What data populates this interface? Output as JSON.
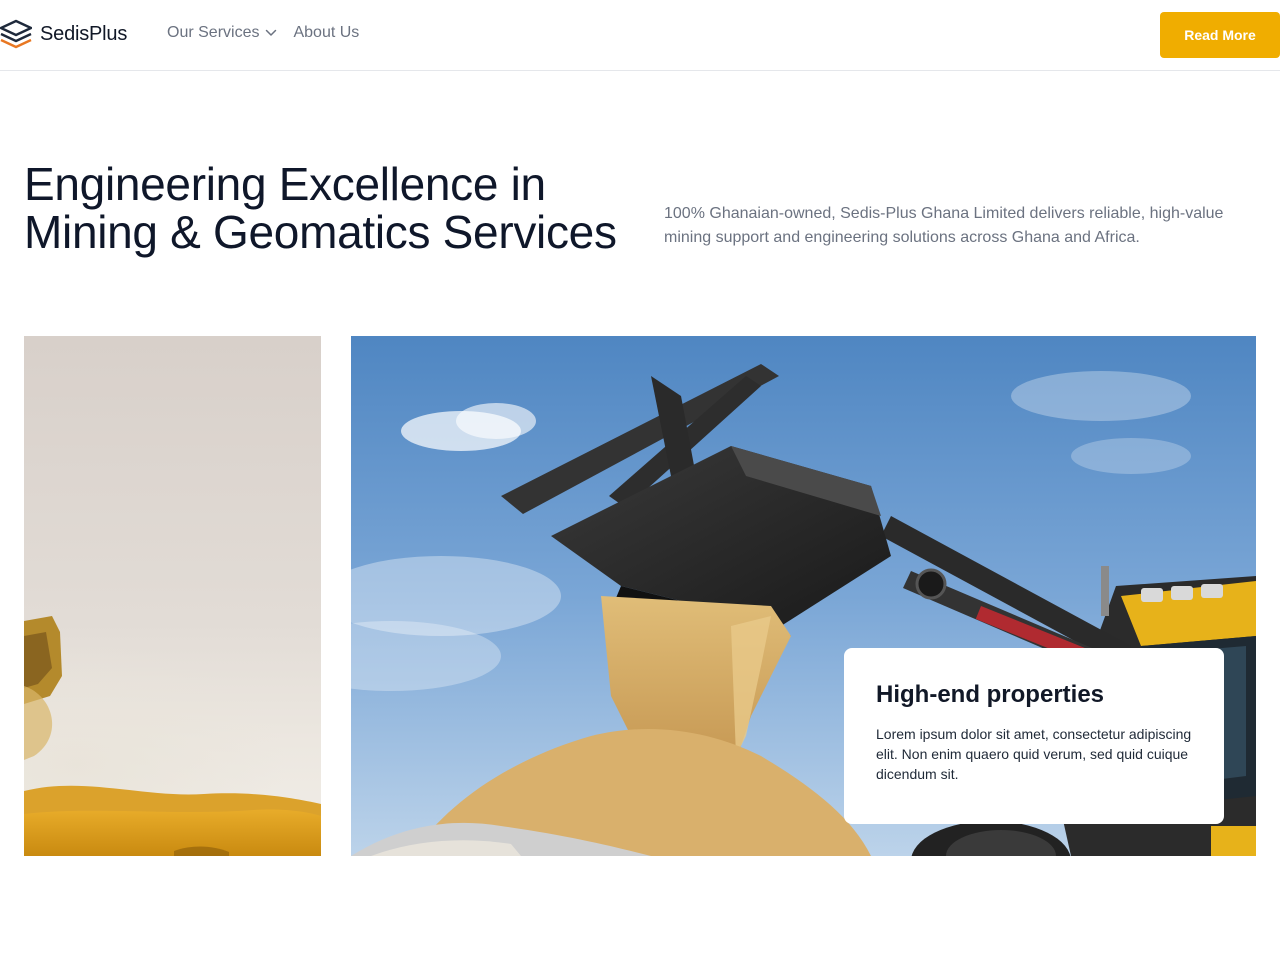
{
  "header": {
    "logo_text": "SedisPlus",
    "nav": {
      "services_label": "Our Services",
      "about_label": "About Us"
    },
    "cta_label": "Read More"
  },
  "hero": {
    "title": "Engineering Excellence in Mining & Geomatics Services",
    "description": "100% Ghanaian-owned, Sedis-Plus Ghana Limited delivers reliable, high-value mining support and engineering solutions across Ghana and Africa."
  },
  "card": {
    "title": "High-end properties",
    "text": "Lorem ipsum dolor sit amet, consectetur adipiscing elit. Non enim quaero quid verum, sed quid cuique dicendum sit."
  },
  "icons": {
    "logo": "stacked-layers-icon",
    "dropdown": "chevron-down-icon"
  },
  "colors": {
    "accent": "#f0ad00",
    "heading": "#0f172a",
    "muted": "#6b7280",
    "logo_primary": "#1e293b",
    "logo_accent": "#e87722"
  }
}
